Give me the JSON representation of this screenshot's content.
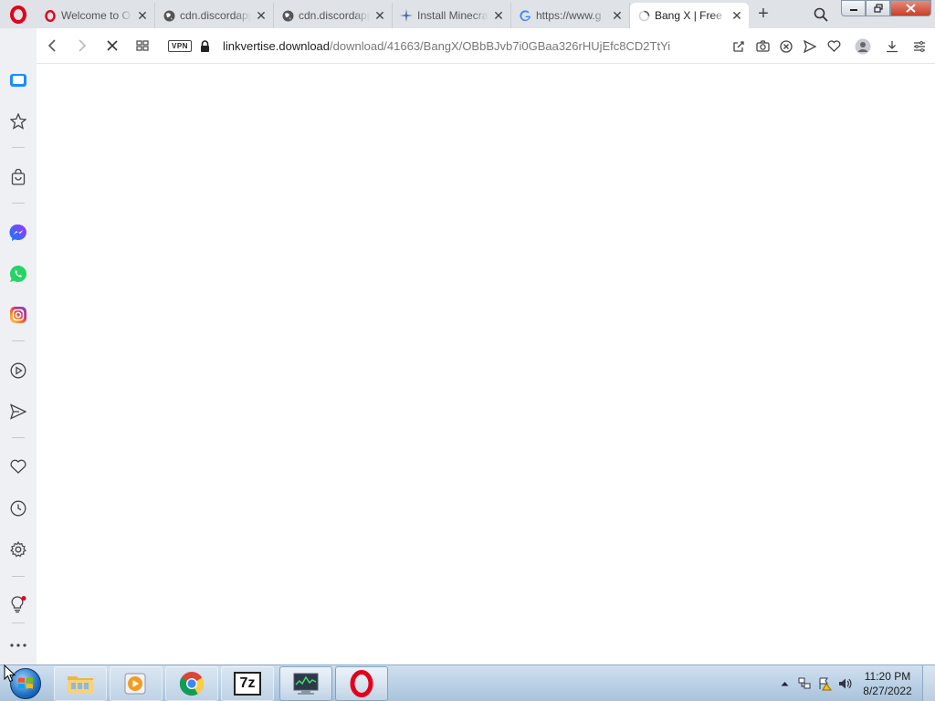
{
  "browser": {
    "tabs": [
      {
        "title": "Welcome to O",
        "icon": "opera-icon",
        "active": false
      },
      {
        "title": "cdn.discordapp",
        "icon": "globe-icon",
        "active": false
      },
      {
        "title": "cdn.discordapp",
        "icon": "globe-icon",
        "active": false
      },
      {
        "title": "Install Minecra",
        "icon": "sparkle-icon",
        "active": false
      },
      {
        "title": "https://www.g",
        "icon": "google-icon",
        "active": false
      },
      {
        "title": "Bang X | Free",
        "icon": "loading-spinner-icon",
        "active": true
      }
    ],
    "new_tab_label": "+",
    "vpn_label": "VPN",
    "url_host": "linkvertise.download",
    "url_path": "/download/41663/BangX/OBbBJvb7i0GBaa326rHUjEfc8CD2TtYi"
  },
  "sidebar": {
    "items": [
      "workspace-icon",
      "bookmarks-icon",
      "shopping-icon",
      "messenger-icon",
      "whatsapp-icon",
      "instagram-icon",
      "player-icon",
      "send-icon",
      "heart-icon",
      "history-icon",
      "settings-icon",
      "tips-icon",
      "more-icon"
    ]
  },
  "taskbar": {
    "apps": [
      "file-explorer-icon",
      "media-player-icon",
      "chrome-icon",
      "7zip-icon",
      "system-monitor-icon",
      "opera-icon"
    ],
    "sevenzip_label": "7z",
    "clock_time": "11:20 PM",
    "clock_date": "8/27/2022"
  },
  "colors": {
    "opera_red": "#e3001b",
    "tabbar_bg": "#dfe3e8",
    "sidebar_bg": "#eef0f3",
    "taskbar_bg": "#b9d0e6",
    "messenger_blue": "#1877f2",
    "whatsapp_green": "#25d366"
  }
}
